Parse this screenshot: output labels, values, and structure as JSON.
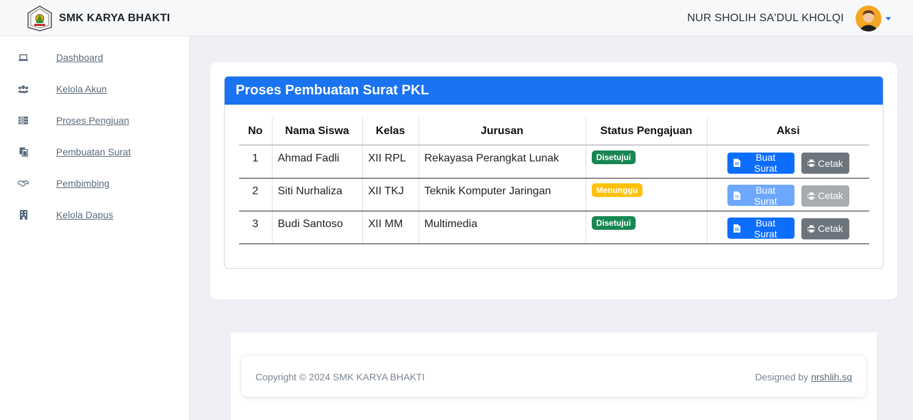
{
  "brand": {
    "name": "SMK KARYA BHAKTI"
  },
  "user": {
    "name": "NUR SHOLIH SA'DUL KHOLQI"
  },
  "sidebar": {
    "items": [
      {
        "label": "Dashboard",
        "icon": "laptop-icon"
      },
      {
        "label": "Kelola Akun",
        "icon": "users-icon"
      },
      {
        "label": "Proses Pengjuan",
        "icon": "list-icon"
      },
      {
        "label": "Pembuatan Surat",
        "icon": "copy-icon"
      },
      {
        "label": "Pembimbing",
        "icon": "handshake-icon"
      },
      {
        "label": "Kelola Dapus",
        "icon": "building-icon"
      }
    ]
  },
  "card": {
    "title": "Proses Pembuatan Surat PKL",
    "header_color": "#1a73f1"
  },
  "table": {
    "headers": [
      "No",
      "Nama Siswa",
      "Kelas",
      "Jurusan",
      "Status Pengajuan",
      "Aksi"
    ],
    "rows": [
      {
        "no": "1",
        "nama": "Ahmad Fadli",
        "kelas": "XII RPL",
        "jurusan": "Rekayasa Perangkat Lunak",
        "status": "Disetujui",
        "status_color": "#198754"
      },
      {
        "no": "2",
        "nama": "Siti Nurhaliza",
        "kelas": "XII TKJ",
        "jurusan": "Teknik Komputer Jaringan",
        "status": "Menunggu",
        "status_color": "#ffc107"
      },
      {
        "no": "3",
        "nama": "Budi Santoso",
        "kelas": "XII MM",
        "jurusan": "Multimedia",
        "status": "Disetujui",
        "status_color": "#198754"
      }
    ],
    "actions": {
      "buat_surat": "Buat Surat",
      "cetak": "Cetak"
    }
  },
  "footer": {
    "copyright": "Copyright © 2024 SMK KARYA BHAKTI",
    "designed_prefix": "Designed by ",
    "designed_link": "nrshlih.sq"
  }
}
